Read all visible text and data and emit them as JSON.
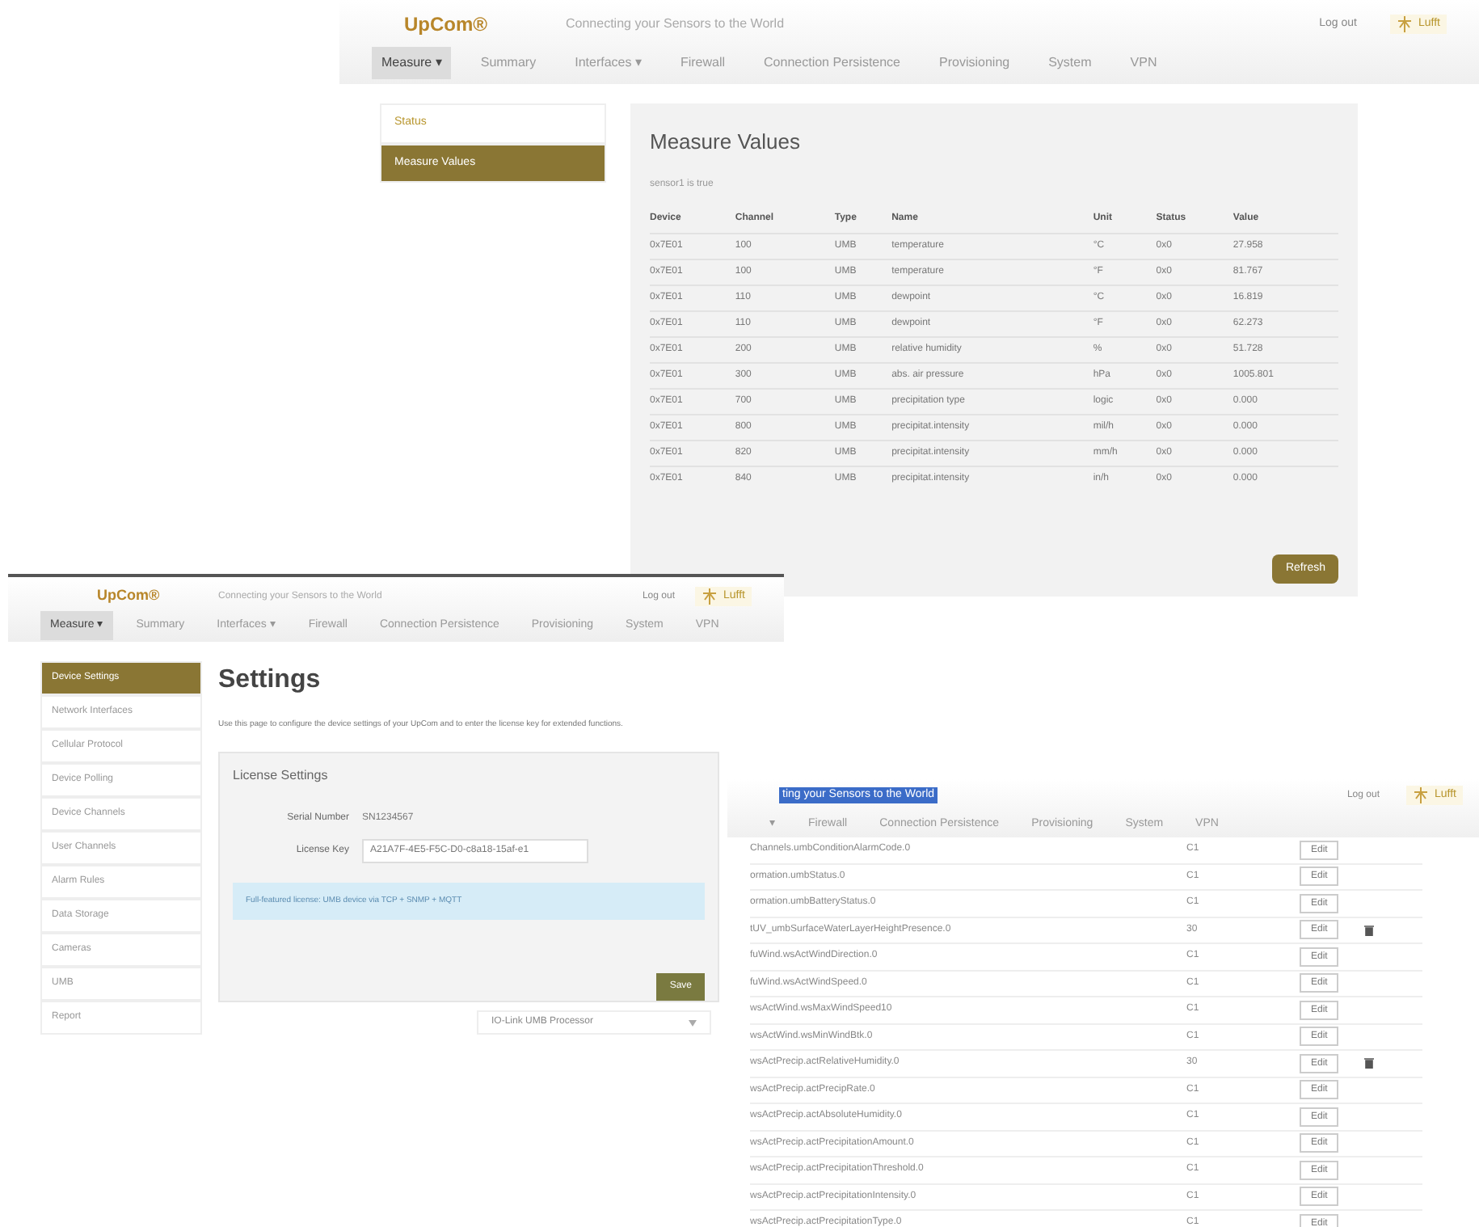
{
  "measure_window": {
    "logo": "UpCom®",
    "tagline": "Connecting your Sensors to the World",
    "logout": "Log out",
    "badge": "Lufft",
    "nav": [
      {
        "label": "Measure ▾",
        "selected": true
      },
      {
        "label": "Summary",
        "selected": false
      },
      {
        "label": "Interfaces ▾",
        "selected": false
      },
      {
        "label": "Firewall",
        "selected": false
      },
      {
        "label": "Connection Persistence",
        "selected": false
      },
      {
        "label": "Provisioning",
        "selected": false
      },
      {
        "label": "System",
        "selected": false
      },
      {
        "label": "VPN",
        "selected": false
      }
    ],
    "sidebar": [
      {
        "label": "Status",
        "selected": false
      },
      {
        "label": "Measure Values",
        "selected": true
      }
    ],
    "title": "Measure Values",
    "subtitle": "sensor1 is true",
    "columns": [
      "Device",
      "Channel",
      "Type",
      "Name",
      "Unit",
      "Status",
      "Value"
    ],
    "rows": [
      [
        "0x7E01",
        "100",
        "UMB",
        "temperature",
        "°C",
        "0x0",
        "27.958"
      ],
      [
        "0x7E01",
        "100",
        "UMB",
        "temperature",
        "°F",
        "0x0",
        "81.767"
      ],
      [
        "0x7E01",
        "110",
        "UMB",
        "dewpoint",
        "°C",
        "0x0",
        "16.819"
      ],
      [
        "0x7E01",
        "110",
        "UMB",
        "dewpoint",
        "°F",
        "0x0",
        "62.273"
      ],
      [
        "0x7E01",
        "200",
        "UMB",
        "relative humidity",
        "%",
        "0x0",
        "51.728"
      ],
      [
        "0x7E01",
        "300",
        "UMB",
        "abs. air pressure",
        "hPa",
        "0x0",
        "1005.801"
      ],
      [
        "0x7E01",
        "700",
        "UMB",
        "precipitation type",
        "logic",
        "0x0",
        "0.000"
      ],
      [
        "0x7E01",
        "800",
        "UMB",
        "precipitat.intensity",
        "mil/h",
        "0x0",
        "0.000"
      ],
      [
        "0x7E01",
        "820",
        "UMB",
        "precipitat.intensity",
        "mm/h",
        "0x0",
        "0.000"
      ],
      [
        "0x7E01",
        "840",
        "UMB",
        "precipitat.intensity",
        "in/h",
        "0x0",
        "0.000"
      ]
    ],
    "refresh": "Refresh"
  },
  "settings_window": {
    "logo": "UpCom®",
    "tagline": "Connecting your Sensors to the World",
    "logout": "Log out",
    "badge": "Lufft",
    "nav": [
      {
        "label": "Measure ▾",
        "selected": true
      },
      {
        "label": "Summary",
        "selected": false
      },
      {
        "label": "Interfaces ▾",
        "selected": false
      },
      {
        "label": "Firewall",
        "selected": false
      },
      {
        "label": "Connection Persistence",
        "selected": false
      },
      {
        "label": "Provisioning",
        "selected": false
      },
      {
        "label": "System",
        "selected": false
      },
      {
        "label": "VPN",
        "selected": false
      }
    ],
    "sidebar": [
      {
        "label": "Device Settings",
        "selected": true
      },
      {
        "label": "Network Interfaces",
        "selected": false
      },
      {
        "label": "Cellular Protocol",
        "selected": false
      },
      {
        "label": "Device Polling",
        "selected": false
      },
      {
        "label": "Device Channels",
        "selected": false
      },
      {
        "label": "User Channels",
        "selected": false
      },
      {
        "label": "Alarm Rules",
        "selected": false
      },
      {
        "label": "Data Storage",
        "selected": false
      },
      {
        "label": "Cameras",
        "selected": false
      },
      {
        "label": "UMB",
        "selected": false
      },
      {
        "label": "Report",
        "selected": false
      }
    ],
    "title": "Settings",
    "description": "Use this page to configure the device settings of your UpCom and to enter the license key for extended functions.",
    "card_title": "License Settings",
    "serial_label": "Serial Number",
    "serial_value": "SN1234567",
    "key_label": "License Key",
    "key_value": "A21A7F-4E5-F5C-D0-c8a18-15af-e1",
    "info": "Full-featured license: UMB device via TCP + SNMP + MQTT",
    "save": "Save",
    "dropdown": "IO-Link UMB Processor"
  },
  "oid_window": {
    "tagline": "ting your Sensors to the World",
    "logout": "Log out",
    "badge": "Lufft",
    "nav": [
      {
        "label": "▾",
        "selected": false
      },
      {
        "label": "Firewall",
        "selected": false
      },
      {
        "label": "Connection Persistence",
        "selected": false
      },
      {
        "label": "Provisioning",
        "selected": false
      },
      {
        "label": "System",
        "selected": false
      },
      {
        "label": "VPN",
        "selected": false
      }
    ],
    "rows": [
      {
        "name": "Channels.umbConditionAlarmCode.0",
        "type": "C1",
        "edit": "Edit",
        "deletable": false
      },
      {
        "name": "ormation.umbStatus.0",
        "type": "C1",
        "edit": "Edit",
        "deletable": false
      },
      {
        "name": "ormation.umbBatteryStatus.0",
        "type": "C1",
        "edit": "Edit",
        "deletable": false
      },
      {
        "name": "tUV_umbSurfaceWaterLayerHeightPresence.0",
        "type": "30",
        "edit": "Edit",
        "deletable": true
      },
      {
        "name": "fuWind.wsActWindDirection.0",
        "type": "C1",
        "edit": "Edit",
        "deletable": false
      },
      {
        "name": "fuWind.wsActWindSpeed.0",
        "type": "C1",
        "edit": "Edit",
        "deletable": false
      },
      {
        "name": "wsActWind.wsMaxWindSpeed10",
        "type": "C1",
        "edit": "Edit",
        "deletable": false
      },
      {
        "name": "wsActWind.wsMinWindBtk.0",
        "type": "C1",
        "edit": "Edit",
        "deletable": false
      },
      {
        "name": "wsActPrecip.actRelativeHumidity.0",
        "type": "30",
        "edit": "Edit",
        "deletable": true
      },
      {
        "name": "wsActPrecip.actPrecipRate.0",
        "type": "C1",
        "edit": "Edit",
        "deletable": false
      },
      {
        "name": "wsActPrecip.actAbsoluteHumidity.0",
        "type": "C1",
        "edit": "Edit",
        "deletable": false
      },
      {
        "name": "wsActPrecip.actPrecipitationAmount.0",
        "type": "C1",
        "edit": "Edit",
        "deletable": false
      },
      {
        "name": "wsActPrecip.actPrecipitationThreshold.0",
        "type": "C1",
        "edit": "Edit",
        "deletable": false
      },
      {
        "name": "wsActPrecip.actPrecipitationIntensity.0",
        "type": "C1",
        "edit": "Edit",
        "deletable": false
      },
      {
        "name": "wsActPrecip.actPrecipitationType.0",
        "type": "C1",
        "edit": "Edit",
        "deletable": false
      }
    ]
  }
}
